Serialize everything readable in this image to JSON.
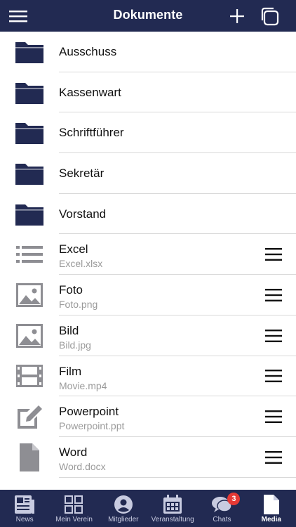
{
  "header": {
    "title": "Dokumente"
  },
  "folders": [
    {
      "label": "Ausschuss"
    },
    {
      "label": "Kassenwart"
    },
    {
      "label": "Schriftführer"
    },
    {
      "label": "Sekretär"
    },
    {
      "label": "Vorstand"
    }
  ],
  "files": [
    {
      "label": "Excel",
      "filename": "Excel.xlsx",
      "icon": "list-icon"
    },
    {
      "label": "Foto",
      "filename": "Foto.png",
      "icon": "image-icon"
    },
    {
      "label": "Bild",
      "filename": "Bild.jpg",
      "icon": "image-icon"
    },
    {
      "label": "Film",
      "filename": "Movie.mp4",
      "icon": "film-icon"
    },
    {
      "label": "Powerpoint",
      "filename": "Powerpoint.ppt",
      "icon": "edit-icon"
    },
    {
      "label": "Word",
      "filename": "Word.docx",
      "icon": "document-icon"
    }
  ],
  "tabs": [
    {
      "label": "News",
      "icon": "newspaper-icon"
    },
    {
      "label": "Mein Verein",
      "icon": "grid-icon"
    },
    {
      "label": "Mitglieder",
      "icon": "person-icon"
    },
    {
      "label": "Veranstaltung",
      "icon": "calendar-icon"
    },
    {
      "label": "Chats",
      "icon": "chat-icon",
      "badge": "3"
    },
    {
      "label": "Media",
      "icon": "file-icon",
      "active": true
    }
  ],
  "colors": {
    "primary": "#222a52",
    "folder": "#222a52",
    "file_icon": "#8e8e93",
    "badge": "#e53935"
  }
}
